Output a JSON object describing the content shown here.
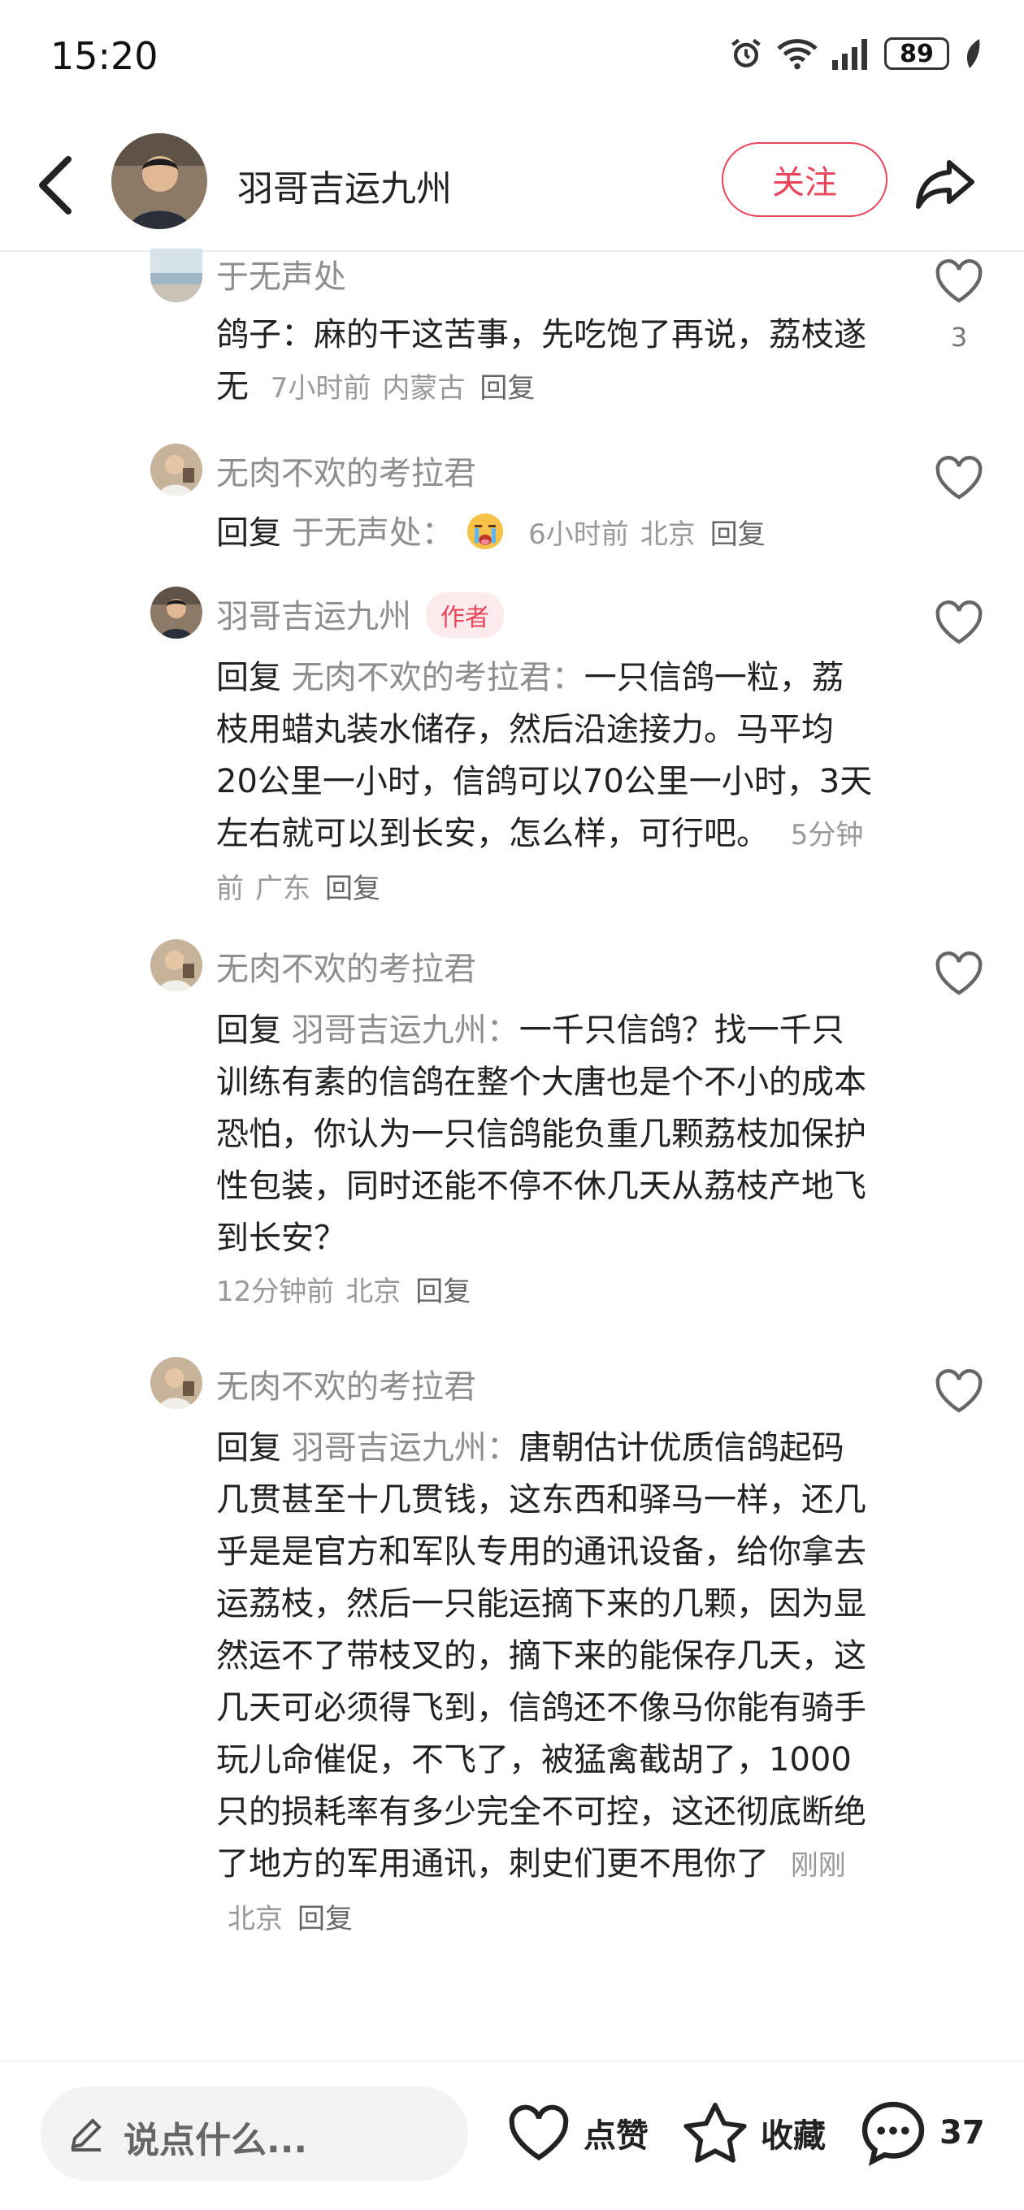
{
  "status": {
    "time": "15:20",
    "battery": "89"
  },
  "header": {
    "name": "羽哥吉运九州",
    "follow_label": "关注"
  },
  "comments": [
    {
      "name": "于无声处",
      "text": "鸽子：麻的干这苦事，先吃饱了再说，荔枝遂无",
      "time": "7小时前",
      "location": "内蒙古",
      "reply_label": "回复",
      "likes": "3"
    },
    {
      "name": "无肉不欢的考拉君",
      "reply_prefix": "回复",
      "reply_target": "于无声处：",
      "time": "6小时前",
      "location": "北京",
      "reply_label": "回复"
    },
    {
      "name": "羽哥吉运九州",
      "tag": "作者",
      "reply_prefix": "回复",
      "reply_target": "无肉不欢的考拉君：",
      "text": "一只信鸽一粒，荔枝用蜡丸装水储存，然后沿途接力。马平均20公里一小时，信鸽可以70公里一小时，3天左右就可以到长安，怎么样，可行吧。",
      "time": "5分钟前",
      "location": "广东",
      "reply_label": "回复"
    },
    {
      "name": "无肉不欢的考拉君",
      "reply_prefix": "回复",
      "reply_target": "羽哥吉运九州：",
      "text": "一千只信鸽？找一千只训练有素的信鸽在整个大唐也是个不小的成本恐怕，你认为一只信鸽能负重几颗荔枝加保护性包装，同时还能不停不休几天从荔枝产地飞到长安？",
      "time": "12分钟前",
      "location": "北京",
      "reply_label": "回复"
    },
    {
      "name": "无肉不欢的考拉君",
      "reply_prefix": "回复",
      "reply_target": "羽哥吉运九州：",
      "text": "唐朝估计优质信鸽起码几贯甚至十几贯钱，这东西和驿马一样，还几乎是是官方和军队专用的通讯设备，给你拿去运荔枝，然后一只能运摘下来的几颗，因为显然运不了带枝叉的，摘下来的能保存几天，这几天可必须得飞到，信鸽还不像马你能有骑手玩儿命催促，不飞了，被猛禽截胡了，1000只的损耗率有多少完全不可控，这还彻底断绝了地方的军用通讯，刺史们更不甩你了",
      "time": "刚刚",
      "location": "北京",
      "reply_label": "回复"
    }
  ],
  "bottom": {
    "placeholder": "说点什么...",
    "like_label": "点赞",
    "collect_label": "收藏",
    "comment_count": "37"
  }
}
